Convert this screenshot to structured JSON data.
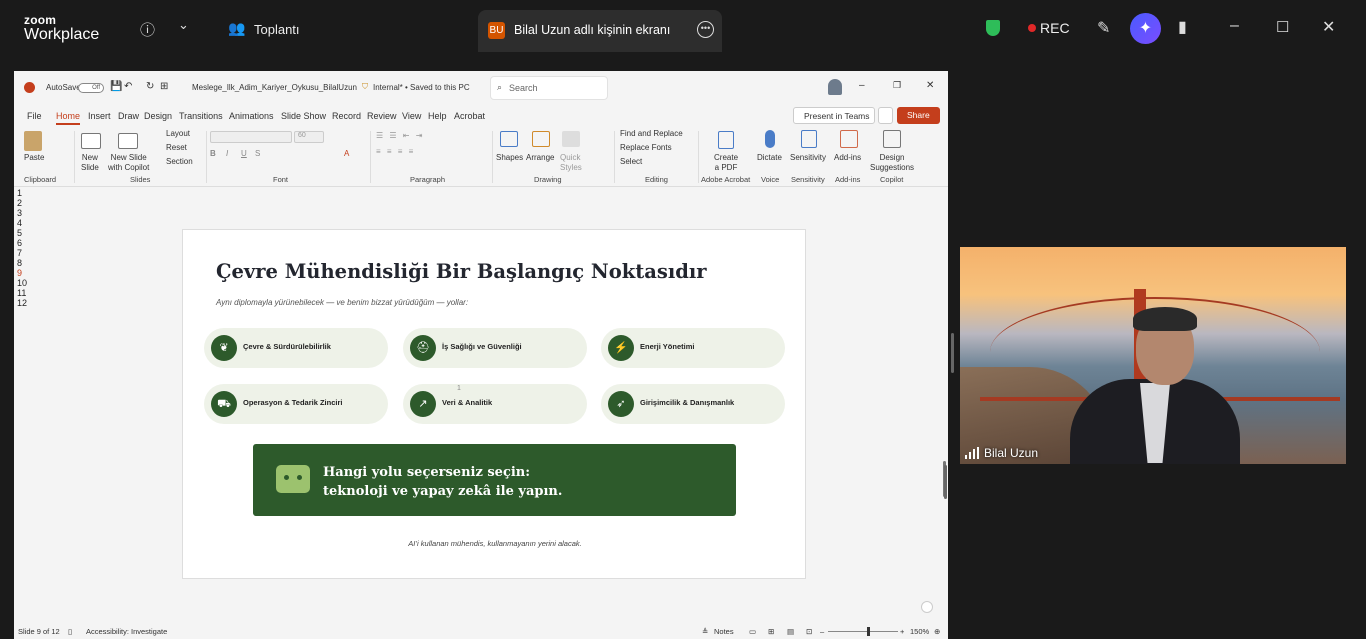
{
  "zoom": {
    "brand_small": "zoom",
    "brand_large": "Workplace",
    "meeting_label": "Toplantı",
    "share_tab": {
      "badge": "BU",
      "title": "Bilal Uzun adlı kişinin ekranı"
    },
    "rec_label": "REC",
    "colors": {
      "bar": "#1a1a1a",
      "rec": "#e02828",
      "secure": "#2ebd59",
      "ai": "#5b4dff"
    }
  },
  "ppt": {
    "autosave": "AutoSave",
    "autosave_state": "Off",
    "filename": "Meslege_Ilk_Adim_Kariyer_Oykusu_BilalUzun",
    "label": "Internal* • Saved to this PC",
    "search_placeholder": "Search",
    "menu": [
      "File",
      "Home",
      "Insert",
      "Draw",
      "Design",
      "Transitions",
      "Animations",
      "Slide Show",
      "Record",
      "Review",
      "View",
      "Help",
      "Acrobat"
    ],
    "active_menu": "Home",
    "present_teams": "Present in Teams",
    "share": "Share",
    "ribbon": {
      "paste": "Paste",
      "clipboard": "Clipboard",
      "new_slide": "New\nSlide",
      "new_slide_copilot": "New Slide\nwith Copilot",
      "layout": "Layout",
      "reset": "Reset",
      "section": "Section",
      "slides": "Slides",
      "font_size": "60",
      "font": "Font",
      "paragraph": "Paragraph",
      "shapes": "Shapes",
      "arrange": "Arrange",
      "quick_styles": "Quick\nStyles",
      "drawing": "Drawing",
      "find_replace": "Find and Replace",
      "replace_fonts": "Replace Fonts",
      "select": "Select",
      "editing": "Editing",
      "create_pdf": "Create\na PDF",
      "adobe": "Adobe Acrobat",
      "dictate": "Dictate",
      "voice": "Voice",
      "sensitivity": "Sensitivity",
      "addins": "Add-ins",
      "design_suggestions": "Design\nSuggestions",
      "copilot": "Copilot"
    },
    "thumb_numbers": [
      "1",
      "2",
      "3",
      "4",
      "5",
      "6",
      "7",
      "8",
      "9",
      "10",
      "11",
      "12"
    ],
    "slide": {
      "title": "Çevre Mühendisliği Bir Başlangıç Noktasıdır",
      "subtitle": "Aynı diplomayla yürünebilecek — ve benim bizzat yürüdüğüm — yollar:",
      "paths": [
        {
          "label": "Çevre & Sürdürülebilirlik",
          "icon": "leaf-icon"
        },
        {
          "label": "İş Sağlığı ve Güvenliği",
          "icon": "helmet-icon"
        },
        {
          "label": "Enerji Yönetimi",
          "icon": "bolt-icon"
        },
        {
          "label": "Operasyon & Tedarik Zinciri",
          "icon": "truck-icon"
        },
        {
          "label": "Veri & Analitik",
          "icon": "chart-icon"
        },
        {
          "label": "Girişimcilik & Danışmanlık",
          "icon": "rocket-icon"
        }
      ],
      "banner_line1": "Hangi yolu seçerseniz seçin:",
      "banner_line2": "teknoloji ve yapay zekâ ile yapın.",
      "footnote": "AI’i kullanan mühendis, kullanmayanın yerini alacak.",
      "page_marker": "1",
      "accent": "#2d5a2b"
    },
    "status": {
      "slide_count": "Slide 9 of 12",
      "accessibility": "Accessibility: Investigate",
      "notes": "Notes",
      "zoom": "150%"
    }
  },
  "video": {
    "participant": "Bilal Uzun"
  }
}
